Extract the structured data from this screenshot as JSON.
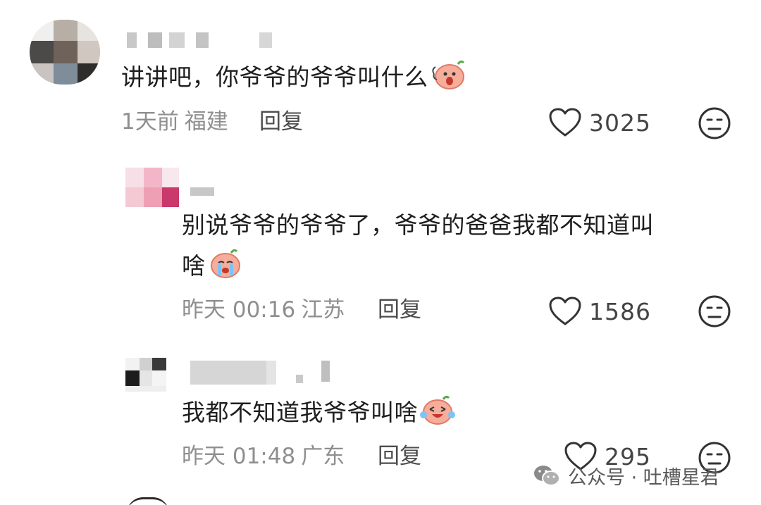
{
  "comments": [
    {
      "text": "讲讲吧，你爷爷的爷爷叫什么",
      "emoji": "surprised-peach-emoji",
      "time": "1天前",
      "location": "福建",
      "reply_label": "回复",
      "likes": "3025"
    },
    {
      "text_line1": "别说爷爷的爷爷了，爷爷的爸爸我都不知道叫",
      "text_line2": "啥",
      "emoji": "crying-peach-emoji",
      "time": "昨天 00:16",
      "location": "江苏",
      "reply_label": "回复",
      "likes": "1586"
    },
    {
      "text": "我都不知道我爷爷叫啥",
      "emoji": "laughing-crying-peach-emoji",
      "time": "昨天 01:48",
      "location": "广东",
      "reply_label": "回复",
      "likes": "295"
    }
  ],
  "watermark": {
    "text": "公众号 · 吐槽星君",
    "icon": "wechat-icon"
  },
  "colors": {
    "text": "#1e1e1e",
    "meta": "#8f8f8f",
    "reply": "#4d4d4d",
    "icon_stroke": "#333333",
    "emoji_peach": "#f4a08e"
  }
}
